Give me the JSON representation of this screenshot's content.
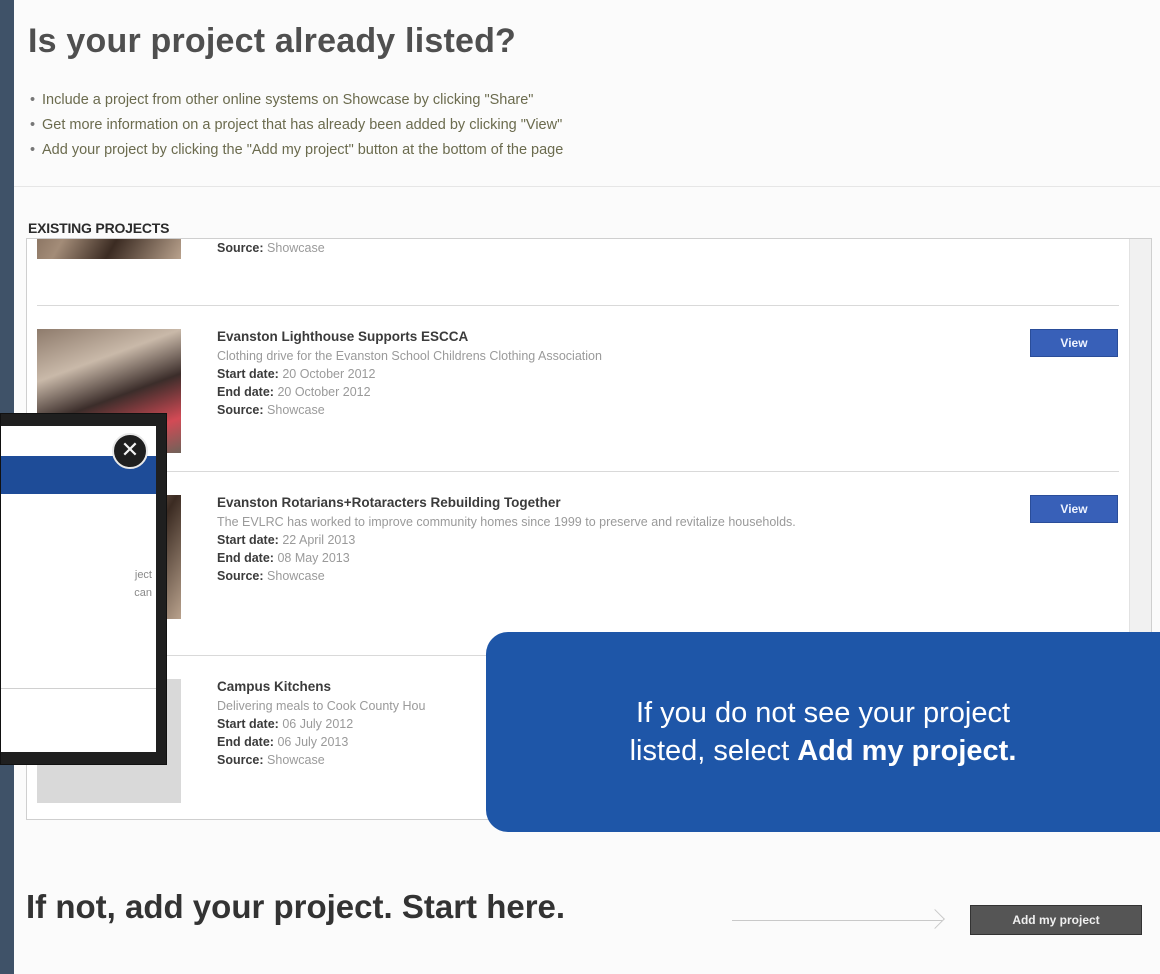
{
  "header": {
    "title": "Is your project already listed?",
    "bullets": [
      "Include a project from other online systems on Showcase by clicking \"Share\"",
      "Get more information on a project that has already been added by clicking \"View\"",
      "Add your project by clicking the \"Add my project\" button at the bottom of the page"
    ]
  },
  "projects_section": {
    "label": "EXISTING PROJECTS",
    "partial_item": {
      "source_label": "Source:",
      "source_value": "Showcase"
    },
    "items": [
      {
        "title": "Evanston Lighthouse Supports ESCCA",
        "description": "Clothing drive for the Evanston School Childrens Clothing Association",
        "start_label": "Start date:",
        "start_value": "20 October 2012",
        "end_label": "End date:",
        "end_value": "20 October 2012",
        "source_label": "Source:",
        "source_value": "Showcase",
        "button": "View"
      },
      {
        "title": "Evanston Rotarians+Rotaracters Rebuilding Together",
        "description": "The EVLRC has worked to improve community homes since 1999 to preserve and revitalize households.",
        "start_label": "Start date:",
        "start_value": "22 April 2013",
        "end_label": "End date:",
        "end_value": "08 May 2013",
        "source_label": "Source:",
        "source_value": "Showcase",
        "button": "View"
      },
      {
        "title": "Campus Kitchens",
        "description": "Delivering meals to Cook County Hou",
        "start_label": "Start date:",
        "start_value": "06 July 2012",
        "end_label": "End date:",
        "end_value": "06 July 2013",
        "source_label": "Source:",
        "source_value": "Showcase"
      }
    ]
  },
  "overlay": {
    "text_line1": "ject",
    "text_line2": "can",
    "close_symbol": "✕"
  },
  "callout": {
    "line1": "If you do not see your project",
    "line2_prefix": "listed, select ",
    "line2_bold": "Add my project."
  },
  "footer": {
    "title": "If not, add your project. Start here.",
    "add_button": "Add my project"
  }
}
